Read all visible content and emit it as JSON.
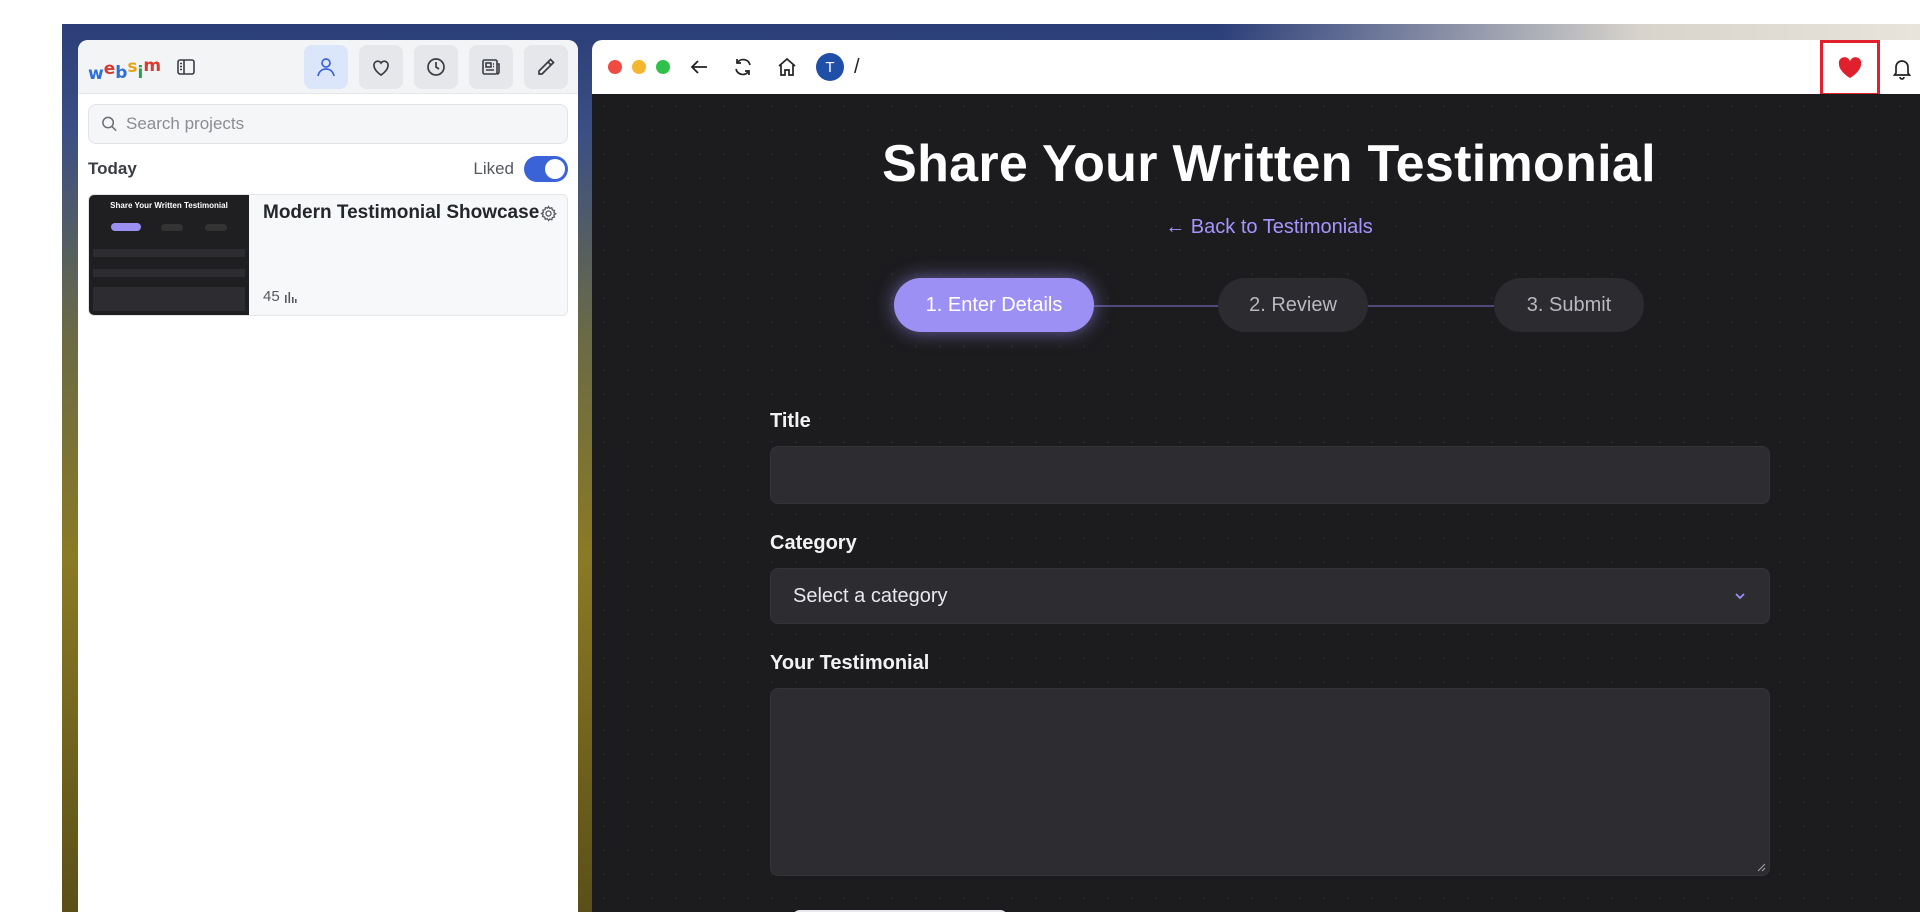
{
  "sidebar": {
    "logo_letters": [
      "w",
      "e",
      "b",
      "s",
      "i",
      "m"
    ],
    "logo_colors": [
      "#2f6fd6",
      "#d93a2e",
      "#2f6fd6",
      "#e8a617",
      "#2aa04a",
      "#d93a2e"
    ],
    "search_placeholder": "Search projects",
    "section_label": "Today",
    "liked_label": "Liked",
    "liked_on": true,
    "project": {
      "title": "Modern Testimonial Showcase",
      "views": "45",
      "thumb_title": "Share Your Written Testimonial"
    }
  },
  "browser": {
    "avatar_letter": "T",
    "path": "/",
    "heart_color": "#e0202c"
  },
  "page": {
    "title": "Share Your Written Testimonial",
    "back_link": "← Back to Testimonials",
    "steps": [
      "1. Enter Details",
      "2. Review",
      "3. Submit"
    ],
    "active_step": 1,
    "title_label": "Title",
    "title_value": "",
    "category_label": "Category",
    "category_value": "Select a category",
    "testimonial_label": "Your Testimonial",
    "testimonial_value": "",
    "accent_color": "#9d90f5"
  }
}
